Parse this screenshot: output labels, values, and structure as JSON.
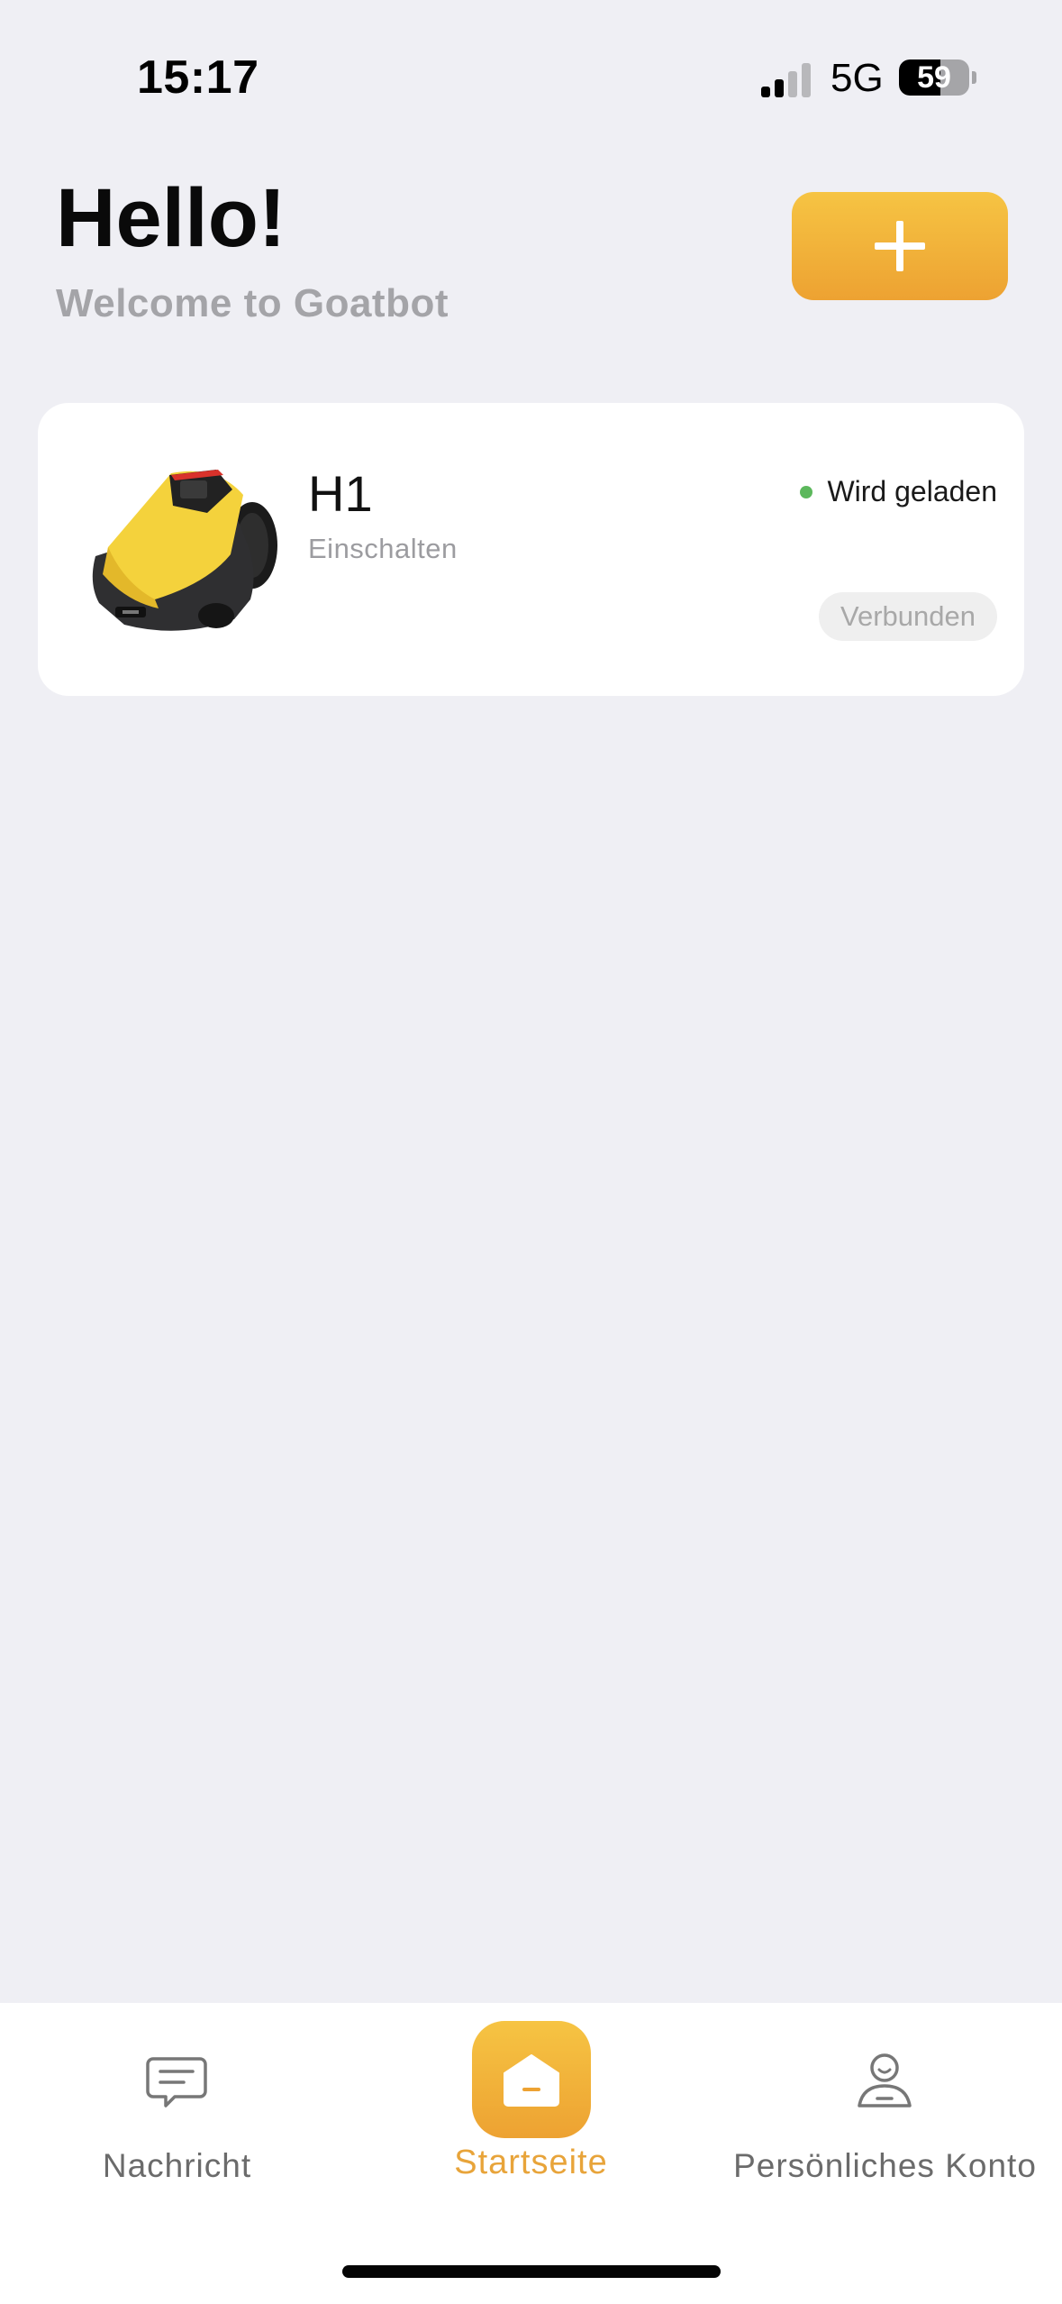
{
  "status_bar": {
    "time": "15:17",
    "network": "5G",
    "battery_level": "59",
    "battery_fraction": 0.59,
    "signal_bars_active": 2,
    "signal_bars_total": 4
  },
  "header": {
    "greeting": "Hello!",
    "subtitle": "Welcome to Goatbot",
    "add_icon": "plus-icon"
  },
  "device": {
    "name": "H1",
    "mode": "Einschalten",
    "status": "Wird geladen",
    "status_color": "#5cb85c",
    "connection": "Verbunden",
    "image": "robot-mower-image"
  },
  "nav": {
    "items": [
      {
        "label": "Nachricht",
        "icon": "message-icon",
        "active": false
      },
      {
        "label": "Startseite",
        "icon": "home-icon",
        "active": true
      },
      {
        "label": "Persönliches Konto",
        "icon": "user-icon",
        "active": false
      }
    ]
  },
  "colors": {
    "accent": "#f0a935",
    "accent_top": "#f6c443",
    "background": "#efeff4",
    "active_label": "#e8a43a"
  }
}
